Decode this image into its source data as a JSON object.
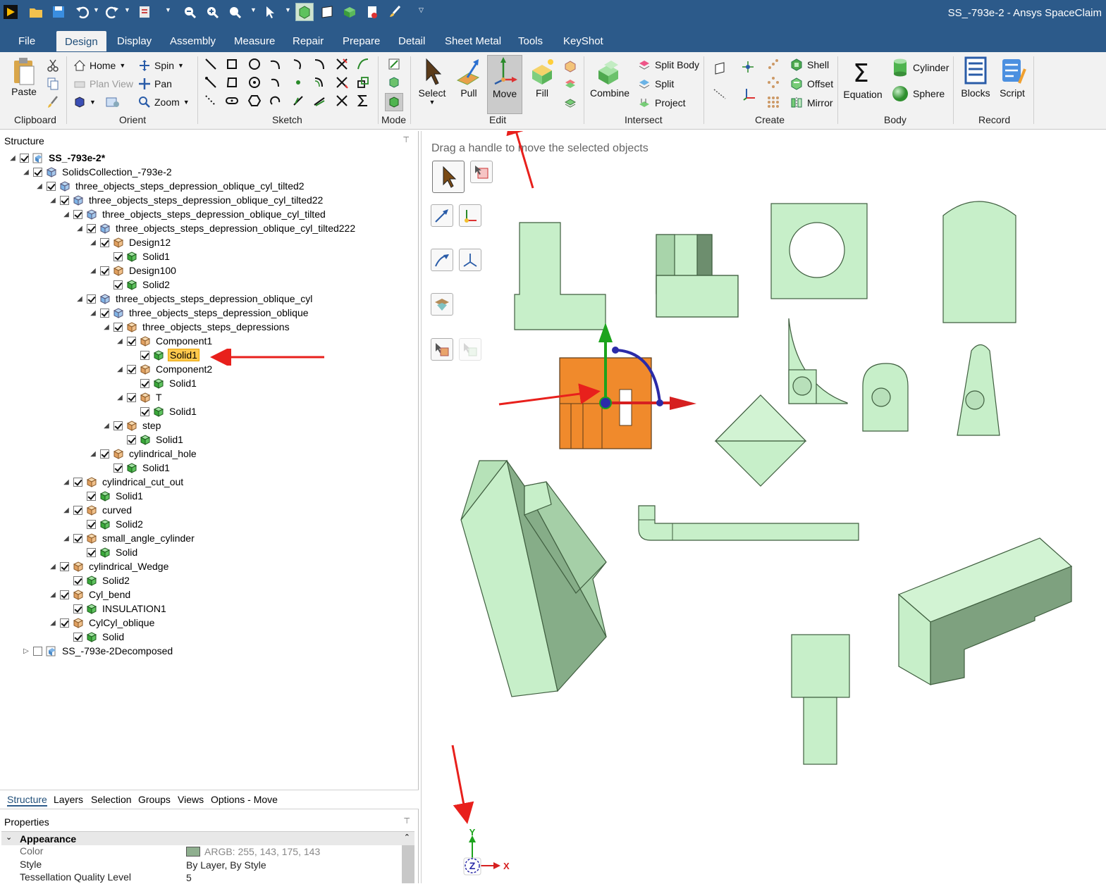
{
  "window": {
    "title": "SS_-793e-2 - Ansys SpaceClaim"
  },
  "menu": {
    "tabs": [
      "File",
      "Design",
      "Display",
      "Assembly",
      "Measure",
      "Repair",
      "Prepare",
      "Detail",
      "Sheet Metal",
      "Tools",
      "KeyShot"
    ],
    "active": "Design"
  },
  "ribbon": {
    "clipboard": {
      "group": "Clipboard",
      "paste": "Paste"
    },
    "orient": {
      "group": "Orient",
      "home": "Home",
      "plan_view": "Plan View",
      "spin": "Spin",
      "pan": "Pan",
      "zoom": "Zoom"
    },
    "sketch": {
      "group": "Sketch"
    },
    "mode": {
      "group": "Mode"
    },
    "edit": {
      "group": "Edit",
      "select": "Select",
      "pull": "Pull",
      "move": "Move",
      "fill": "Fill"
    },
    "intersect": {
      "group": "Intersect",
      "combine": "Combine",
      "split_body": "Split Body",
      "split": "Split",
      "project": "Project"
    },
    "create": {
      "group": "Create",
      "shell": "Shell",
      "offset": "Offset",
      "mirror": "Mirror"
    },
    "body": {
      "group": "Body",
      "equation": "Equation",
      "cylinder": "Cylinder",
      "sphere": "Sphere"
    },
    "record": {
      "group": "Record",
      "blocks": "Blocks",
      "script": "Script"
    }
  },
  "structure": {
    "title": "Structure",
    "nodes": [
      {
        "label": "SS_-793e-2*",
        "depth": 0,
        "type": "root",
        "bold": true
      },
      {
        "label": "SolidsCollection_-793e-2",
        "depth": 1,
        "type": "assembly"
      },
      {
        "label": "three_objects_steps_depression_oblique_cyl_tilted2",
        "depth": 2,
        "type": "assembly"
      },
      {
        "label": "three_objects_steps_depression_oblique_cyl_tilted22",
        "depth": 3,
        "type": "assembly"
      },
      {
        "label": "three_objects_steps_depression_oblique_cyl_tilted",
        "depth": 4,
        "type": "assembly"
      },
      {
        "label": "three_objects_steps_depression_oblique_cyl_tilted222",
        "depth": 5,
        "type": "assembly"
      },
      {
        "label": "Design12",
        "depth": 6,
        "type": "component"
      },
      {
        "label": "Solid1",
        "depth": 7,
        "type": "solid"
      },
      {
        "label": "Design100",
        "depth": 6,
        "type": "component"
      },
      {
        "label": "Solid2",
        "depth": 7,
        "type": "solid"
      },
      {
        "label": "three_objects_steps_depression_oblique_cyl",
        "depth": 5,
        "type": "assembly"
      },
      {
        "label": "three_objects_steps_depression_oblique",
        "depth": 6,
        "type": "assembly"
      },
      {
        "label": "three_objects_steps_depressions",
        "depth": 7,
        "type": "component"
      },
      {
        "label": "Component1",
        "depth": 8,
        "type": "component"
      },
      {
        "label": "Solid1",
        "depth": 9,
        "type": "solid",
        "selected": true
      },
      {
        "label": "Component2",
        "depth": 8,
        "type": "component"
      },
      {
        "label": "Solid1",
        "depth": 9,
        "type": "solid"
      },
      {
        "label": "T",
        "depth": 8,
        "type": "component"
      },
      {
        "label": "Solid1",
        "depth": 9,
        "type": "solid"
      },
      {
        "label": "step",
        "depth": 7,
        "type": "component"
      },
      {
        "label": "Solid1",
        "depth": 8,
        "type": "solid"
      },
      {
        "label": "cylindrical_hole",
        "depth": 6,
        "type": "component"
      },
      {
        "label": "Solid1",
        "depth": 7,
        "type": "solid"
      },
      {
        "label": "cylindrical_cut_out",
        "depth": 4,
        "type": "component"
      },
      {
        "label": "Solid1",
        "depth": 5,
        "type": "solid"
      },
      {
        "label": "curved",
        "depth": 4,
        "type": "component"
      },
      {
        "label": "Solid2",
        "depth": 5,
        "type": "solid"
      },
      {
        "label": "small_angle_cylinder",
        "depth": 4,
        "type": "component"
      },
      {
        "label": "Solid",
        "depth": 5,
        "type": "solid"
      },
      {
        "label": "cylindrical_Wedge",
        "depth": 3,
        "type": "component"
      },
      {
        "label": "Solid2",
        "depth": 4,
        "type": "solid"
      },
      {
        "label": "Cyl_bend",
        "depth": 3,
        "type": "component"
      },
      {
        "label": "INSULATION1",
        "depth": 4,
        "type": "solid"
      },
      {
        "label": "CylCyl_oblique",
        "depth": 3,
        "type": "component"
      },
      {
        "label": "Solid",
        "depth": 4,
        "type": "solid"
      },
      {
        "label": "SS_-793e-2Decomposed",
        "depth": 1,
        "type": "root",
        "collapsed": true,
        "unchecked": true
      }
    ]
  },
  "bottom_tabs": [
    "Structure",
    "Layers",
    "Selection",
    "Groups",
    "Views",
    "Options - Move"
  ],
  "properties": {
    "title": "Properties",
    "section": "Appearance",
    "rows": [
      {
        "key": "Color",
        "value": "ARGB: 255, 143, 175, 143",
        "dim": true
      },
      {
        "key": "Style",
        "value": "By Layer, By Style"
      },
      {
        "key": "Tessellation Quality Level",
        "value": "5"
      }
    ]
  },
  "viewport": {
    "hint": "Drag a handle to move the selected objects",
    "axes": {
      "x": "X",
      "y": "Y",
      "z": "Z"
    }
  },
  "colors": {
    "accent": "#2c5a8a",
    "body_fill": "#c7efc9",
    "body_edge": "#3f5e3f",
    "selected": "#f08a2c",
    "annotation": "#e8201c"
  }
}
